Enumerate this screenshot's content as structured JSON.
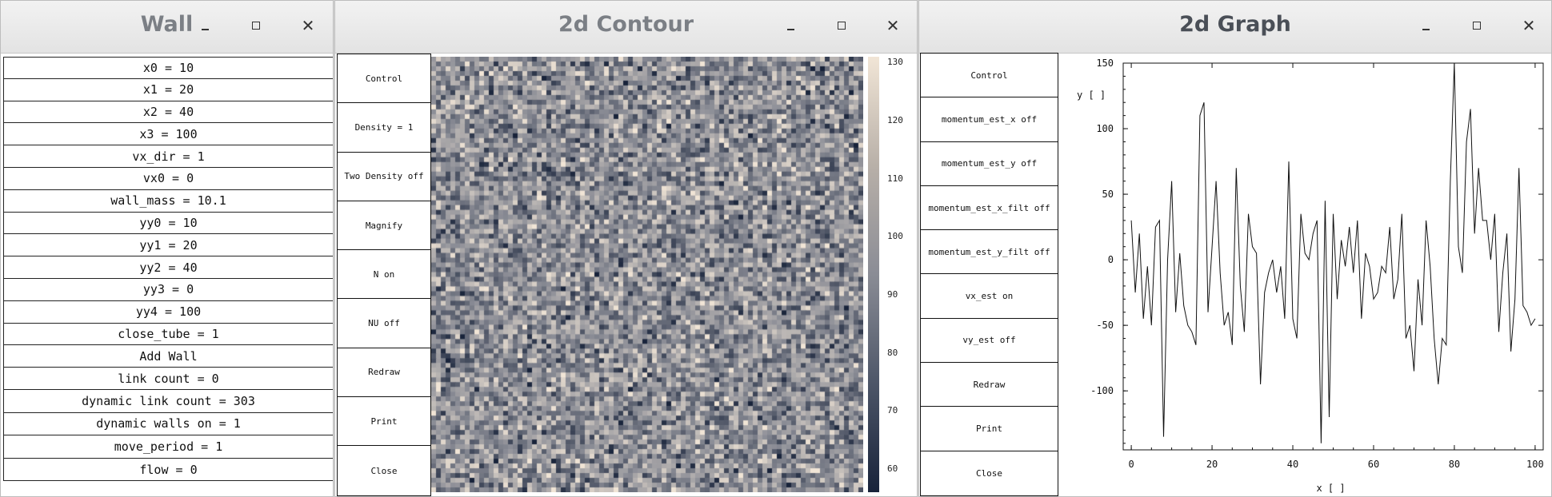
{
  "wall": {
    "title": "Wall",
    "items": [
      "x0 = 10",
      "x1 = 20",
      "x2 = 40",
      "x3 = 100",
      "vx_dir = 1",
      "vx0 = 0",
      "wall_mass = 10.1",
      "yy0 = 10",
      "yy1 = 20",
      "yy2 = 40",
      "yy3 = 0",
      "yy4 = 100",
      "close_tube = 1",
      "Add Wall",
      "link count = 0",
      "dynamic link count = 303",
      "dynamic walls on = 1",
      "move_period = 1",
      "flow = 0"
    ]
  },
  "contour": {
    "title": "2d Contour",
    "buttons": [
      "Control",
      "Density = 1",
      "Two Density  off",
      "Magnify",
      "N on",
      "NU off",
      "Redraw",
      "Print",
      "Close"
    ],
    "colorbar_ticks": [
      "130",
      "120",
      "110",
      "100",
      "90",
      "80",
      "70",
      "60"
    ],
    "colorbar_range": [
      56,
      131
    ],
    "colormap": {
      "low": "#18233a",
      "mid": "#8a8c95",
      "high": "#f1e5d6"
    }
  },
  "graph": {
    "title": "2d Graph",
    "buttons": [
      "Control",
      "momentum_est_x off",
      "momentum_est_y off",
      "momentum_est_x_filt off",
      "momentum_est_y_filt off",
      "vx_est on",
      "vy_est off",
      "Redraw",
      "Print",
      "Close"
    ]
  },
  "chart_data": {
    "type": "line",
    "xlabel": "x [ ]",
    "ylabel": "y [ ]",
    "xlim": [
      -2,
      102
    ],
    "ylim": [
      -145,
      150
    ],
    "xticks": [
      "0",
      "20",
      "40",
      "60",
      "80",
      "100"
    ],
    "yticks": [
      "150",
      "100",
      "50",
      "0",
      "-50",
      "-100"
    ],
    "x": [
      0,
      1,
      2,
      3,
      4,
      5,
      6,
      7,
      8,
      9,
      10,
      11,
      12,
      13,
      14,
      15,
      16,
      17,
      18,
      19,
      20,
      21,
      22,
      23,
      24,
      25,
      26,
      27,
      28,
      29,
      30,
      31,
      32,
      33,
      34,
      35,
      36,
      37,
      38,
      39,
      40,
      41,
      42,
      43,
      44,
      45,
      46,
      47,
      48,
      49,
      50,
      51,
      52,
      53,
      54,
      55,
      56,
      57,
      58,
      59,
      60,
      61,
      62,
      63,
      64,
      65,
      66,
      67,
      68,
      69,
      70,
      71,
      72,
      73,
      74,
      75,
      76,
      77,
      78,
      79,
      80,
      81,
      82,
      83,
      84,
      85,
      86,
      87,
      88,
      89,
      90,
      91,
      92,
      93,
      94,
      95,
      96,
      97,
      98,
      99,
      100
    ],
    "y": [
      30,
      -25,
      20,
      -45,
      -5,
      -50,
      25,
      30,
      -135,
      0,
      60,
      -40,
      5,
      -35,
      -50,
      -55,
      -65,
      110,
      120,
      -40,
      10,
      60,
      -10,
      -50,
      -40,
      -65,
      70,
      -20,
      -55,
      35,
      10,
      5,
      -95,
      -25,
      -10,
      0,
      -25,
      -5,
      -45,
      75,
      -45,
      -60,
      35,
      5,
      0,
      20,
      30,
      -140,
      45,
      -120,
      35,
      -30,
      15,
      -5,
      25,
      -10,
      30,
      -45,
      5,
      -5,
      -30,
      -25,
      -5,
      -10,
      25,
      -30,
      -15,
      35,
      -60,
      -50,
      -85,
      -15,
      -50,
      30,
      -5,
      -60,
      -95,
      -60,
      -65,
      60,
      150,
      10,
      -10,
      90,
      115,
      20,
      70,
      30,
      30,
      0,
      35,
      -55,
      -10,
      20,
      -70,
      -30,
      70,
      -35,
      -40,
      -50,
      -45
    ]
  }
}
